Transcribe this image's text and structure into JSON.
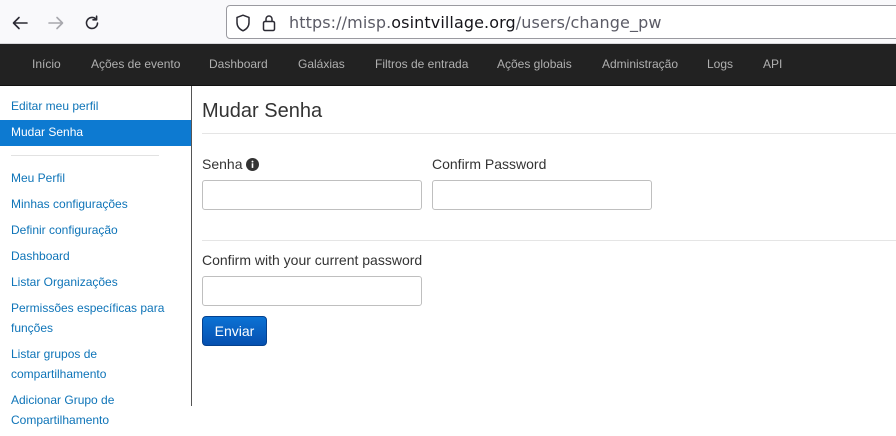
{
  "browser": {
    "url_scheme": "https://misp.",
    "url_host": "osintvillage.org",
    "url_path": "/users/change_pw",
    "icons": [
      "back-arrow-icon",
      "forward-arrow-icon",
      "reload-icon",
      "shield-icon",
      "lock-icon"
    ]
  },
  "navbar": {
    "items": [
      "Início",
      "Ações de evento",
      "Dashboard",
      "Galáxias",
      "Filtros de entrada",
      "Ações globais",
      "Administração",
      "Logs",
      "API"
    ]
  },
  "sidebar": {
    "items": [
      {
        "label": "Editar meu perfil"
      },
      {
        "label": "Mudar Senha",
        "active": true
      },
      {
        "label": "Meu Perfil"
      },
      {
        "label": "Minhas configurações"
      },
      {
        "label": "Definir configuração"
      },
      {
        "label": "Dashboard"
      },
      {
        "label": "Listar Organizações"
      },
      {
        "label": "Permissões específicas para funções",
        "line1": "Permissões específicas para",
        "line2": "funções"
      },
      {
        "label": "Listar grupos de compartilhamento",
        "line1": "Listar grupos de",
        "line2": "compartilhamento"
      },
      {
        "label": "Adicionar Grupo de Compartilhamento",
        "line1": "Adicionar Grupo de",
        "line2": "Compartilhamento"
      }
    ]
  },
  "form": {
    "title": "Mudar Senha",
    "password_label": "Senha",
    "password_value": "",
    "confirm_label": "Confirm Password",
    "confirm_value": "",
    "current_label": "Confirm with your current password",
    "current_value": "",
    "submit_label": "Enviar"
  },
  "colors": {
    "navbar_bg": "#222222",
    "active_item_bg": "#0d7ad1",
    "link": "#0e74b8",
    "button": "#0a63c8"
  }
}
